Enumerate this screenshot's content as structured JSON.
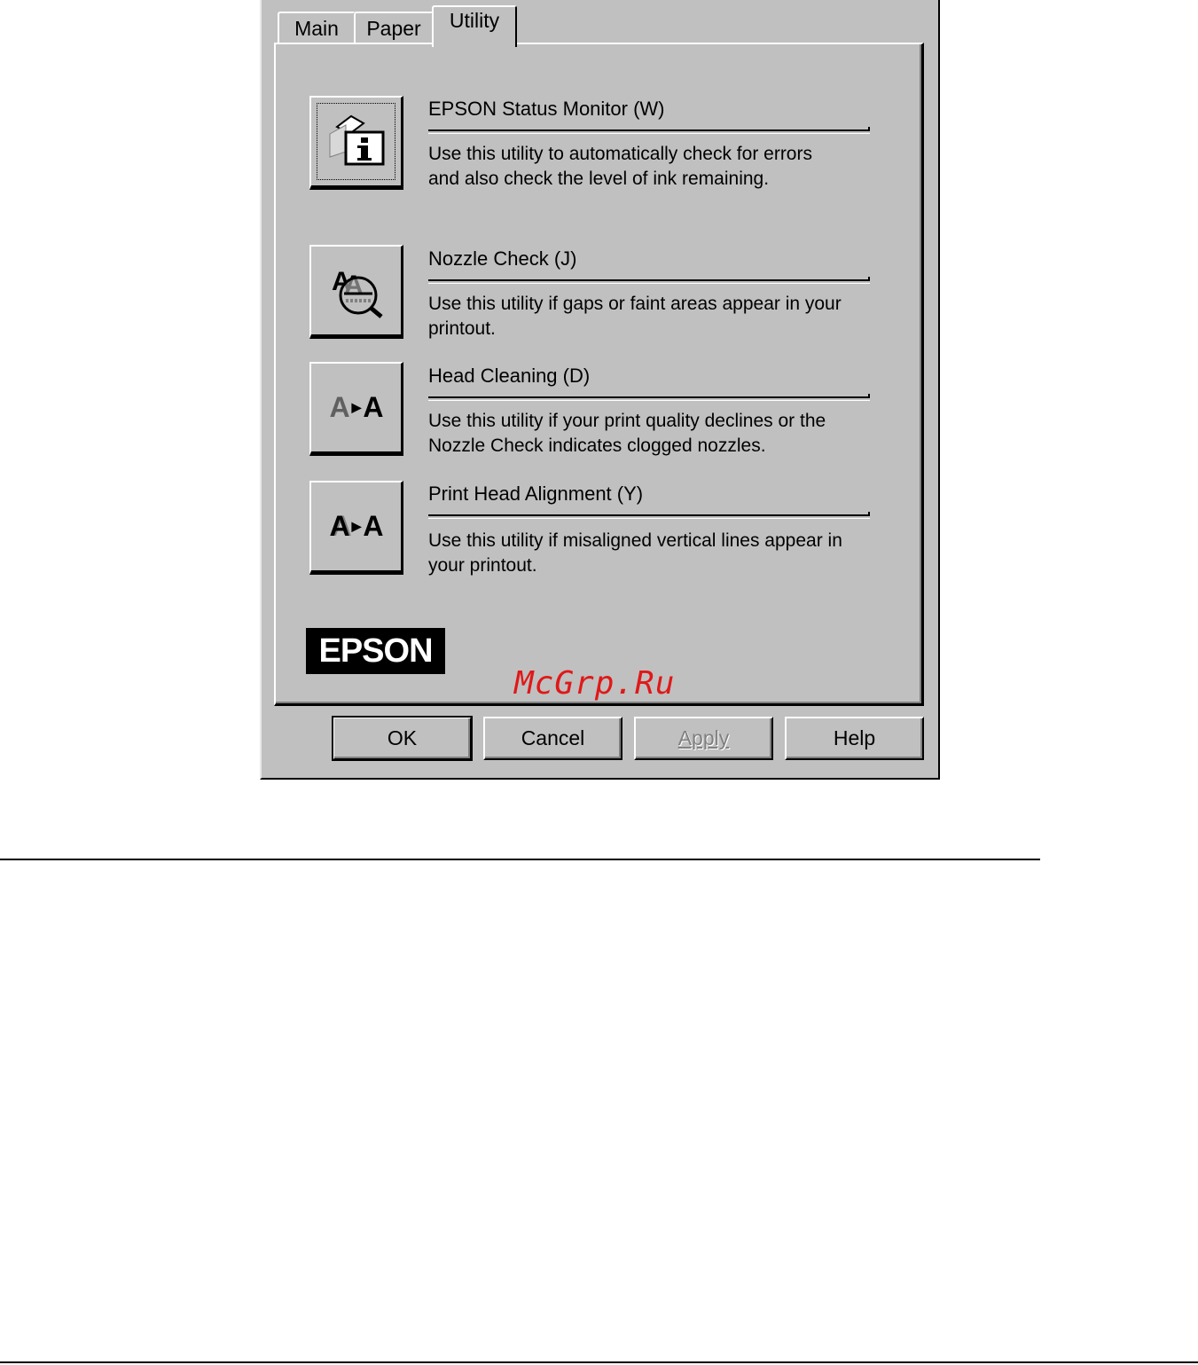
{
  "tabs": [
    {
      "label": "Main",
      "active": false
    },
    {
      "label": "Paper",
      "active": false
    },
    {
      "label": "Utility",
      "active": true
    }
  ],
  "utilities": [
    {
      "title": "EPSON Status Monitor (W)",
      "description_line1": "Use this utility to automatically check for errors",
      "description_line2": "and also check the level of ink remaining.",
      "icon": "status-monitor-icon"
    },
    {
      "title": "Nozzle Check (J)",
      "description_line1": "Use this utility if gaps or faint areas appear in your",
      "description_line2": "printout.",
      "icon": "nozzle-check-icon"
    },
    {
      "title": "Head Cleaning (D)",
      "description_line1": "Use this utility if your print quality declines or the",
      "description_line2": "Nozzle Check indicates clogged nozzles.",
      "icon": "head-cleaning-icon",
      "icon_text": {
        "left": "A",
        "right": "A"
      }
    },
    {
      "title": "Print Head Alignment (Y)",
      "description_line1": "Use this utility if misaligned vertical lines appear in",
      "description_line2": "your printout.",
      "icon": "print-head-alignment-icon",
      "icon_text": {
        "left": "A",
        "right": "A"
      }
    }
  ],
  "logo": "EPSON",
  "buttons": {
    "ok": "OK",
    "cancel": "Cancel",
    "apply": "Apply",
    "help": "Help"
  },
  "watermark": "McGrp.Ru",
  "colors": {
    "dialog_bg": "#c0c0c0",
    "watermark": "#e01818"
  }
}
